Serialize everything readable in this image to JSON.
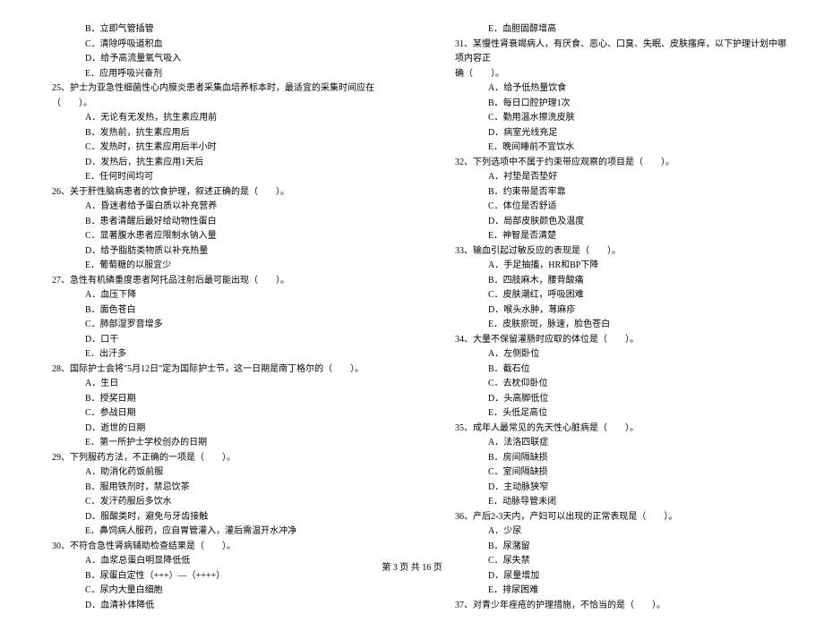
{
  "column_left": {
    "pre_options": [
      "B．立即气管插管",
      "C．清除呼吸道积血",
      "D．给予高流量氧气吸入",
      "E．应用呼吸兴奋剂"
    ],
    "questions": [
      {
        "number": "25、",
        "stem": "护士为亚急性细菌性心内膜炎患者采集血培养标本时，最适宜的采集时间应在（　　）。",
        "options": [
          "A．无论有无发热，抗生素应用前",
          "B．发热前，抗生素应用后",
          "C．发热时，抗生素应用后半小时",
          "D．发热后，抗生素应用1天后",
          "E．任何时间均可"
        ]
      },
      {
        "number": "26、",
        "stem": "关于肝性脑病患者的饮食护理，叙述正确的是（　　）。",
        "options": [
          "A．昏迷者给予蛋白质以补充营养",
          "B．患者清醒后最好给动物性蛋白",
          "C．显著腹水患者应限制水钠入量",
          "D．给予脂肪类物质以补充热量",
          "E．葡萄糖的以服宜少"
        ]
      },
      {
        "number": "27、",
        "stem": "急性有机磷重度患者阿托品注射后最可能出现（　　）。",
        "options": [
          "A．血压下降",
          "B．面色苍白",
          "C．肺部湿罗音增多",
          "D．口干",
          "E．出汗多"
        ]
      },
      {
        "number": "28、",
        "stem": "国际护士会将\"5月12日\"定为国际护士节，这一日期是南丁格尔的（　　）。",
        "options": [
          "A．生日",
          "B．授奖日期",
          "C．参战日期",
          "D．逝世的日期",
          "E．第一所护士学校创办的日期"
        ]
      },
      {
        "number": "29、",
        "stem": "下列服药方法，不正确的一项是（　　）。",
        "options": [
          "A．助消化药饭前服",
          "B．服用铁剂时，禁忌饮茶",
          "C．发汗药服后多饮水",
          "D．服酸类时，避免与牙齿接触",
          "E．鼻饲病人服药，应自胃管灌入，灌后需温开水冲净"
        ]
      },
      {
        "number": "30、",
        "stem": "不符合急性肾病辅助检查结果是（　　）。",
        "options": [
          "A．血浆总蛋白明显降低低",
          "B．尿蛋白定性（+++）—（++++）",
          "C．尿内大量白细胞",
          "D．血清补体降低"
        ]
      }
    ]
  },
  "column_right": {
    "pre_options": [
      "E．血胆固醇增高"
    ],
    "questions": [
      {
        "number": "31、",
        "stem_line1": "某慢性肾衰竭病人，有厌食、恶心、口臭、失眠、皮肤瘙痒，以下护理计划中哪项内容正",
        "stem_line2": "确（　　）。",
        "options": [
          "A．给予低热量饮食",
          "B．每日口腔护理1次",
          "C．勤用温水擦洗皮肤",
          "D．病室光线充足",
          "E．晚间睡前不宜饮水"
        ]
      },
      {
        "number": "32、",
        "stem": "下列选项中不属于约束带应观察的项目是（　　）。",
        "options": [
          "A．衬垫是否垫好",
          "B．约束带是否牢靠",
          "C．体位是否舒适",
          "D．局部皮肤颜色及温度",
          "E．神智是否清楚"
        ]
      },
      {
        "number": "33、",
        "stem": "输血引起过敏反应的表现是（　　）。",
        "options": [
          "A．手足抽搐，HR和BP下降",
          "B．四肢麻木，腰背酸痛",
          "C．皮肤潮红，呼吸困难",
          "D．喉头水肿，荨麻疹",
          "E．皮肤瘀斑，脉速，脸色苍白"
        ]
      },
      {
        "number": "34、",
        "stem": "大量不保留灌肠时应取的体位是（　　）。",
        "options": [
          "A．左侧卧位",
          "B．截石位",
          "C．去枕仰卧位",
          "D．头高脚低位",
          "E．头低足高位"
        ]
      },
      {
        "number": "35、",
        "stem": "成年人最常见的先天性心脏病是（　　）。",
        "options": [
          "A．法洛四联症",
          "B．房间隔缺损",
          "C．室间隔缺损",
          "D．主动脉狭窄",
          "E．动脉导管未闭"
        ]
      },
      {
        "number": "36、",
        "stem": "产后2-3天内，产妇可以出现的正常表现是（　　）。",
        "options": [
          "A．少尿",
          "B．尿潴留",
          "C．尿失禁",
          "D．尿量增加",
          "E．排尿困难"
        ]
      },
      {
        "number": "37、",
        "stem": "对青少年痤疮的护理措施，不恰当的是（　　）。",
        "options": []
      }
    ]
  },
  "footer": "第 3 页 共 16 页"
}
